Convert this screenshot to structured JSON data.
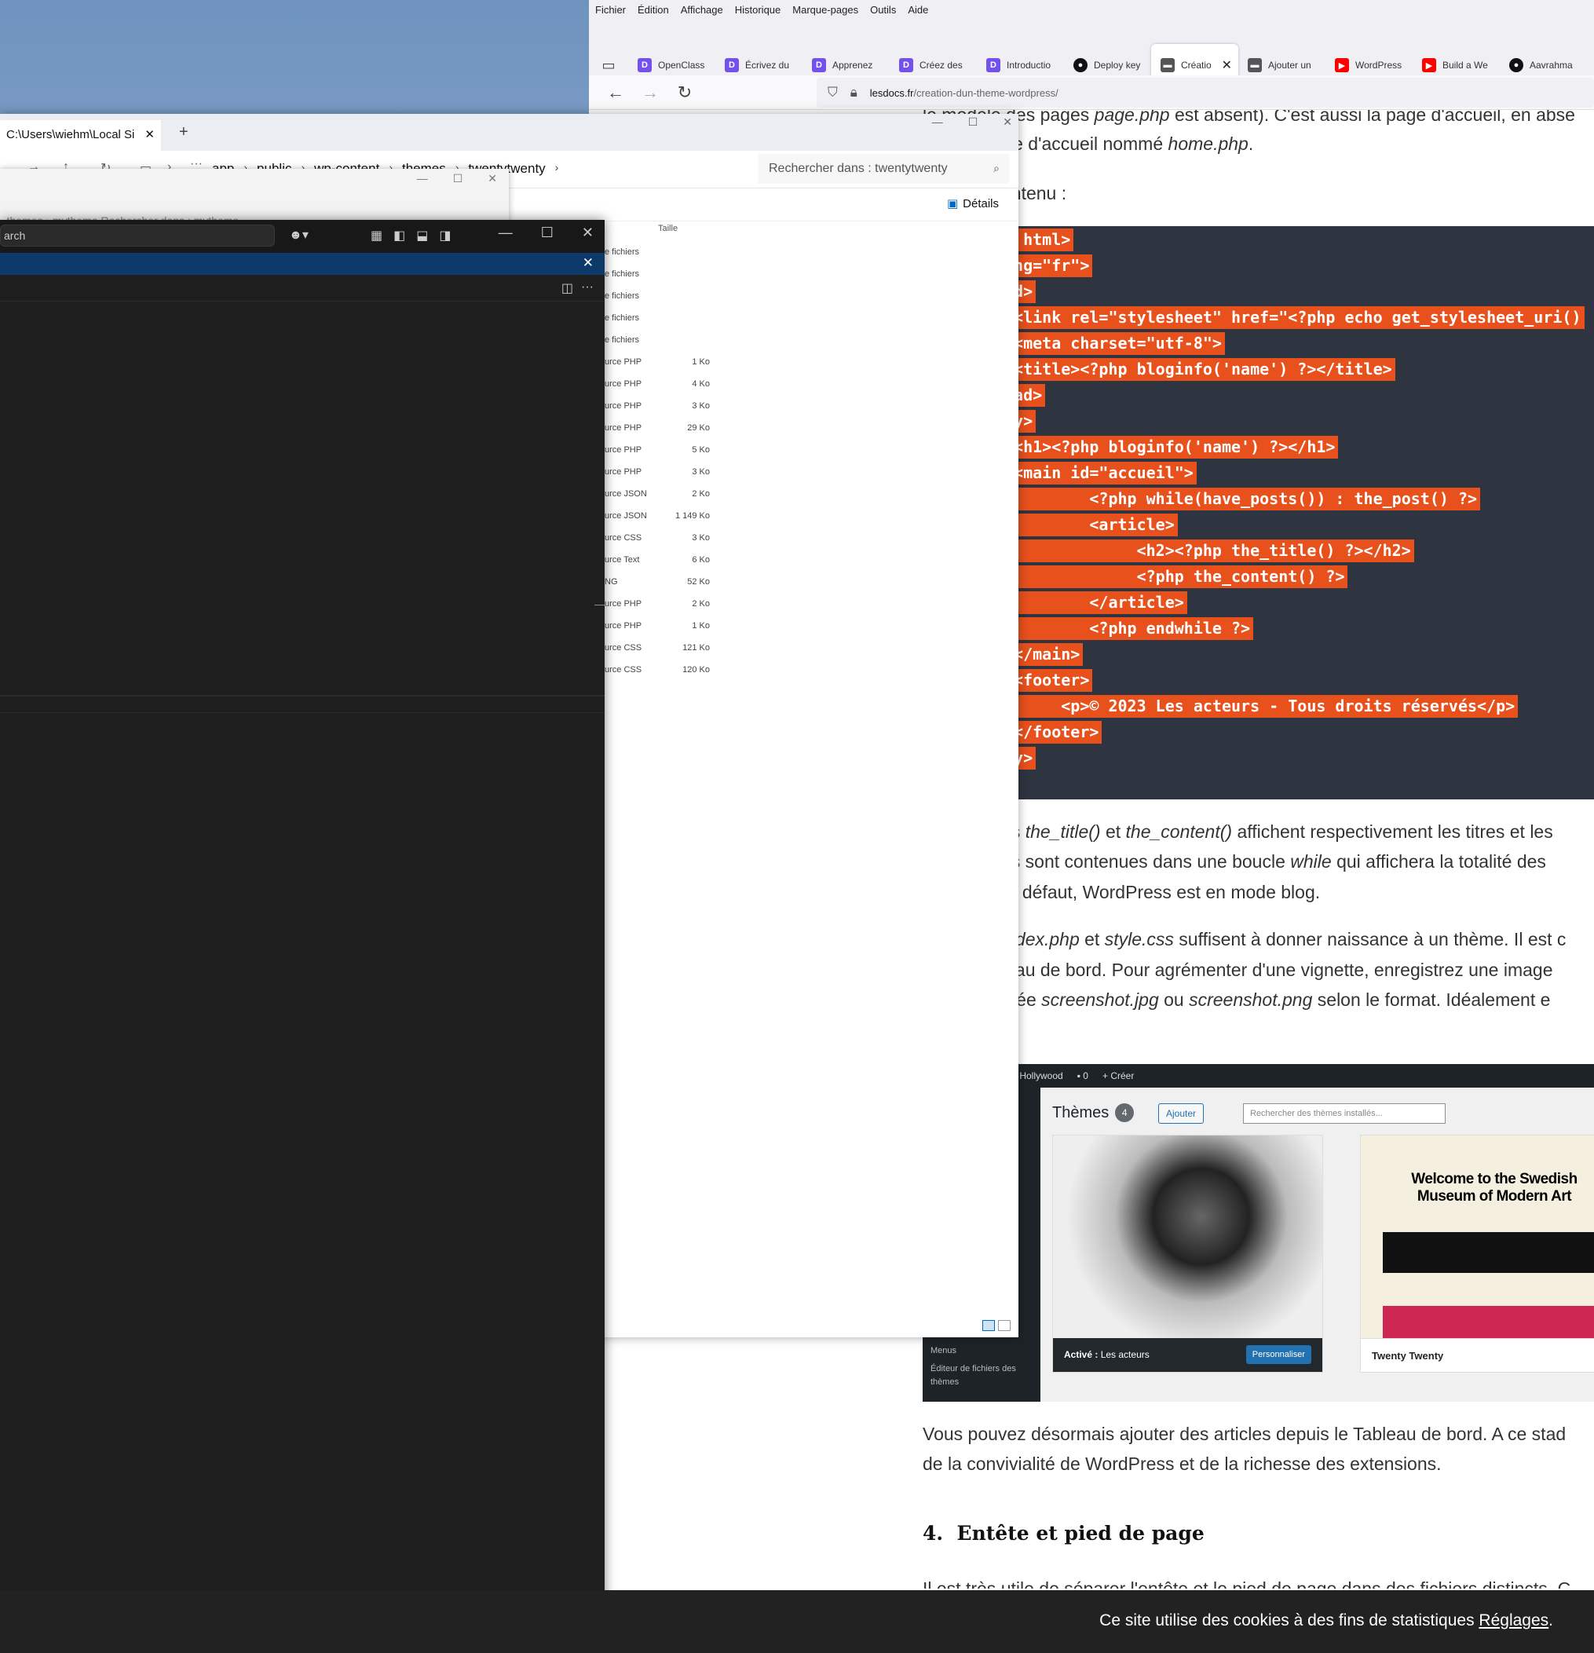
{
  "firefox": {
    "menubar": [
      "Fichier",
      "Édition",
      "Affichage",
      "Historique",
      "Marque-pages",
      "Outils",
      "Aide"
    ],
    "tabs": [
      {
        "label": "OpenClass",
        "icon": "openclassrooms-icon",
        "color": "#7451eb"
      },
      {
        "label": "Écrivez du",
        "icon": "openclassrooms-icon",
        "color": "#7451eb"
      },
      {
        "label": "Apprenez",
        "icon": "openclassrooms-icon",
        "color": "#7451eb"
      },
      {
        "label": "Créez des",
        "icon": "openclassrooms-icon",
        "color": "#7451eb"
      },
      {
        "label": "Introductio",
        "icon": "openclassrooms-icon",
        "color": "#7451eb"
      },
      {
        "label": "Deploy key",
        "icon": "github-icon",
        "color": "#111111"
      },
      {
        "label": "Créatio",
        "icon": "lesdocs-icon",
        "color": "#555555",
        "active": true
      },
      {
        "label": "Ajouter un",
        "icon": "lesdocs-icon",
        "color": "#555555"
      },
      {
        "label": "WordPress",
        "icon": "youtube-icon",
        "color": "#ff0000"
      },
      {
        "label": "Build a We",
        "icon": "youtube-icon",
        "color": "#ff0000"
      },
      {
        "label": "Aavrahma",
        "icon": "github-icon",
        "color": "#111111"
      }
    ],
    "url_domain": "lesdocs.fr",
    "url_path": "/creation-dun-theme-wordpress/",
    "page": {
      "line1_pre": "le modèle des pages ",
      "line1_file": "page.php",
      "line1_post": " est absent). C'est aussi la page d'accueil, en abse",
      "line2_pre": "pour la page d'accueil nommé ",
      "line2_file": "home.php",
      "line2_post": ".",
      "line3": "ontenu :",
      "code": [
        "E html>",
        "ang=\"fr\">",
        "ad>",
        " <link rel=\"stylesheet\" href=\"<?php echo get_stylesheet_uri()",
        " <meta charset=\"utf-8\">",
        " <title><?php bloginfo('name') ?></title>",
        "ead>",
        "dy>",
        " <h1><?php bloginfo('name') ?></h1>",
        " <main id=\"accueil\">",
        "         <?php while(have_posts()) : the_post() ?>",
        "         <article>",
        "              <h2><?php the_title() ?></h2>",
        "              <?php the_content() ?>",
        "         </article>",
        "         <?php endwhile ?>",
        " </main>",
        " <footer>",
        "      <p>© 2023 Les acteurs - Tous droits réservés</p>",
        " </footer>",
        "dy>"
      ],
      "p1_a": "ns ",
      "p1_f1": "the_title()",
      "p1_b": " et ",
      "p1_f2": "the_content()",
      "p1_c": " affichent respectivement les titres et les",
      "p2_a": "ns sont contenues dans une boucle ",
      "p2_f": "while",
      "p2_b": " qui affichera la totalité des",
      "p3": "ar défaut, WordPress est en mode blog.",
      "p4_f1": "index.php",
      "p4_a": " et ",
      "p4_f2": "style.css",
      "p4_b": " suffisent à donner naissance à un thème. Il est c",
      "p5": "leau de bord. Pour agrémenter d'une vignette, enregistrez une image",
      "p6_a": "mée ",
      "p6_f1": "screenshot.jpg",
      "p6_b": " ou ",
      "p6_f2": "screenshot.png",
      "p6_c": " selon le format. Idéalement e",
      "wp": {
        "adminbar_site": "et Hollywood",
        "adminbar_comments": "0",
        "adminbar_new": "Créer",
        "title": "Thèmes",
        "count": "4",
        "add": "Ajouter",
        "search_placeholder": "Rechercher des thèmes installés...",
        "active_label": "Activé :",
        "active_theme": "Les acteurs",
        "customize": "Personnaliser",
        "theme2_preview_title": "Welcome to the Swedish Museum of Modern Art",
        "theme2_name": "Twenty Twenty",
        "side_menus": "Menus",
        "side_editor": "Éditeur de fichiers des thèmes"
      },
      "p7": "Vous pouvez désormais ajouter des articles depuis le Tableau de bord. A ce stad",
      "p8": "de la convivialité de WordPress et de la richesse des extensions.",
      "h4_num": "4.",
      "h4_title": "Entête et pied de page",
      "p9": "Il est très utile de séparer l'entête et le pied de page dans des fichiers distincts. C",
      "cookie_text": "Ce site utilise des cookies à des fins de statistiques ",
      "cookie_link": "Réglages"
    }
  },
  "explorer": {
    "tab_title": "C:\\Users\\wiehm\\Local Si",
    "breadcrumb": [
      "app",
      "public",
      "wp-content",
      "themes",
      "twentytwenty"
    ],
    "search_placeholder": "Rechercher dans : twentytwenty",
    "details_label": "Détails",
    "col_size": "Taille",
    "rows": [
      {
        "type": "e fichiers",
        "size": ""
      },
      {
        "type": "e fichiers",
        "size": ""
      },
      {
        "type": "e fichiers",
        "size": ""
      },
      {
        "type": "e fichiers",
        "size": ""
      },
      {
        "type": "e fichiers",
        "size": ""
      },
      {
        "type": "urce PHP",
        "size": "1 Ko"
      },
      {
        "type": "urce PHP",
        "size": "4 Ko"
      },
      {
        "type": "urce PHP",
        "size": "3 Ko"
      },
      {
        "type": "urce PHP",
        "size": "29 Ko"
      },
      {
        "type": "urce PHP",
        "size": "5 Ko"
      },
      {
        "type": "urce PHP",
        "size": "3 Ko"
      },
      {
        "type": "urce JSON",
        "size": "2 Ko"
      },
      {
        "type": "urce JSON",
        "size": "1 149 Ko"
      },
      {
        "type": "urce CSS",
        "size": "3 Ko"
      },
      {
        "type": "urce Text",
        "size": "6 Ko"
      },
      {
        "type": "NG",
        "size": "52 Ko"
      },
      {
        "type": "urce PHP",
        "size": "2 Ko"
      },
      {
        "type": "urce PHP",
        "size": "1 Ko"
      },
      {
        "type": "urce CSS",
        "size": "121 Ko"
      },
      {
        "type": "urce CSS",
        "size": "120 Ko"
      }
    ]
  },
  "explorer2": {
    "faded_path": "› themes  ›  mytheme            Rechercher dans : mytheme"
  },
  "vscode": {
    "command_center": "arch"
  }
}
